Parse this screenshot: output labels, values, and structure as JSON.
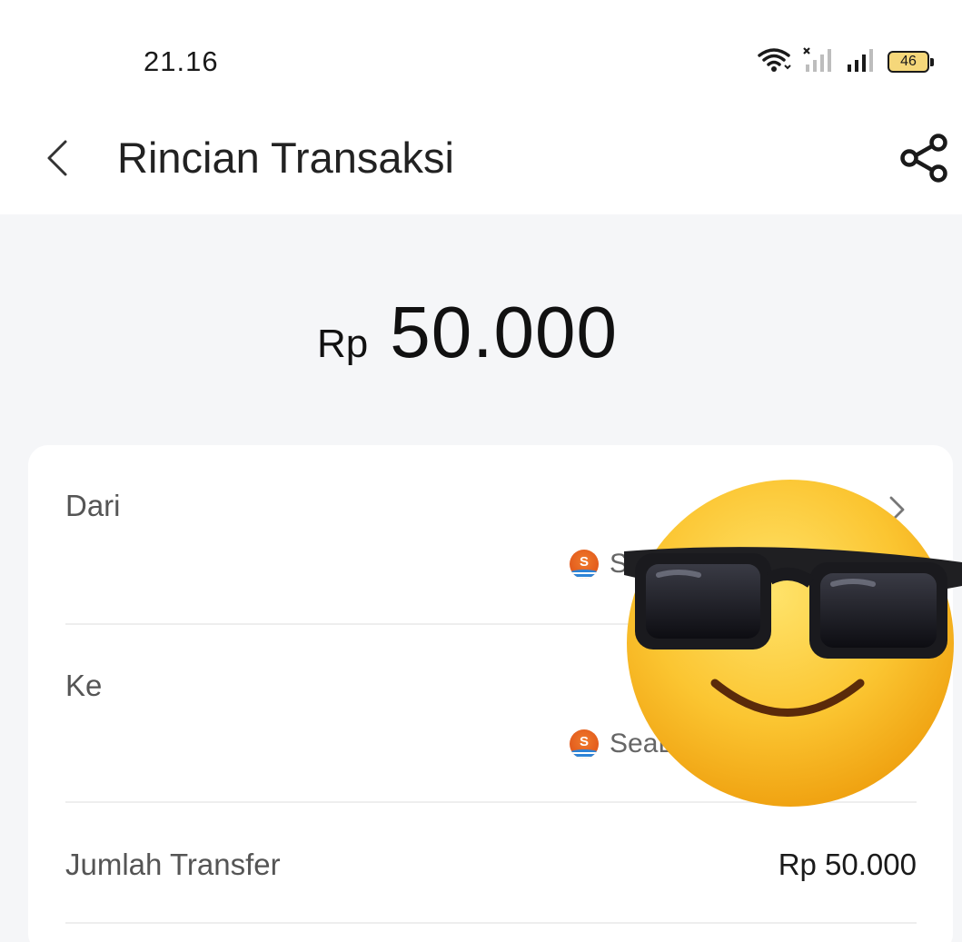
{
  "status_bar": {
    "time": "21.16",
    "battery": "46"
  },
  "header": {
    "title": "Rincian Transaksi"
  },
  "amount": {
    "currency": "Rp",
    "value": "50.000"
  },
  "details": {
    "from": {
      "label": "Dari",
      "bank": "S"
    },
    "to": {
      "label": "Ke",
      "bank": "SeaB"
    },
    "transfer_amount": {
      "label": "Jumlah Transfer",
      "value": "Rp 50.000"
    }
  },
  "colors": {
    "background": "#f5f6f8",
    "card": "#ffffff",
    "text": "#1f1f1f",
    "muted_text": "#555555",
    "bank_orange": "#e25a1c",
    "battery_fill": "#f5d77a"
  },
  "icons": [
    "back-chevron-icon",
    "share-icon",
    "wifi-icon",
    "signal-icon",
    "battery-icon",
    "chevron-right-icon",
    "bank-logo-icon",
    "sunglasses-emoji-sticker"
  ]
}
